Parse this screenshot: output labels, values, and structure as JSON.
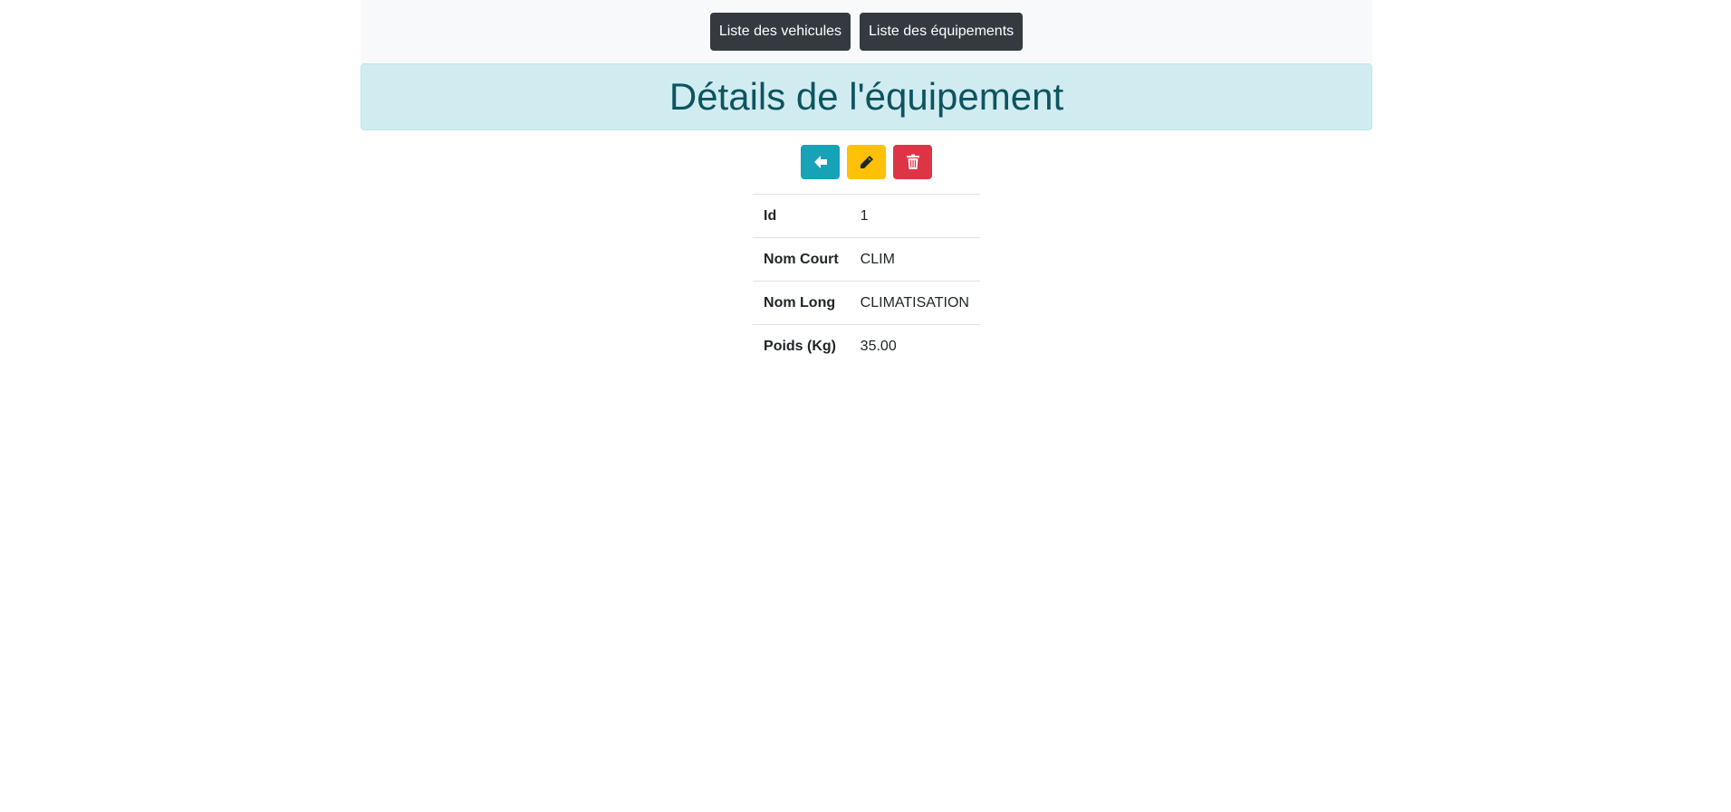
{
  "nav": {
    "vehicles_label": "Liste des vehicules",
    "equipments_label": "Liste des équipements"
  },
  "header": {
    "title": "Détails de l'équipement"
  },
  "actions": {
    "back_icon": "arrow-left-icon",
    "edit_icon": "pencil-icon",
    "delete_icon": "trash-icon",
    "colors": {
      "back": "#17a2b8",
      "edit": "#ffc107",
      "delete": "#dc3545"
    }
  },
  "details": {
    "rows": [
      {
        "label": "Id",
        "value": "1"
      },
      {
        "label": "Nom Court",
        "value": "CLIM"
      },
      {
        "label": "Nom Long",
        "value": "CLIMATISATION"
      },
      {
        "label": "Poids (Kg)",
        "value": "35.00"
      }
    ]
  }
}
